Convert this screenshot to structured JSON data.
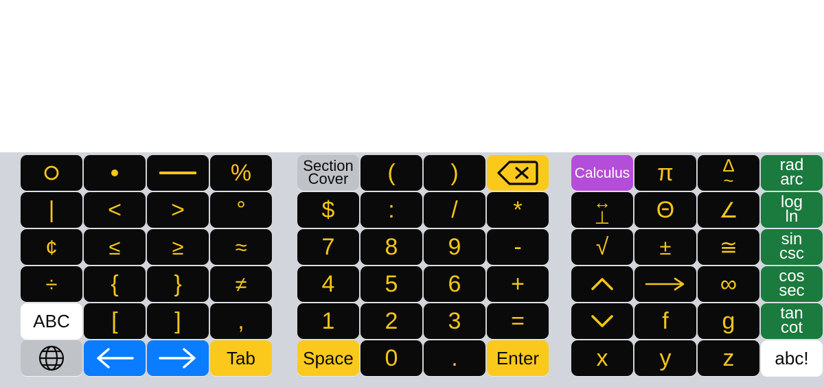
{
  "app": {
    "screen_name": "math-symbol-keyboard",
    "background_color": "#ffffff",
    "keyboard_background": "#d2d5db"
  },
  "colors": {
    "key_black": "#0a0a0a",
    "key_text_yellow": "#f5c518",
    "key_yellow": "#fbc91b",
    "key_blue": "#0a7cff",
    "key_green": "#1b7a3d",
    "key_purple": "#b44dd9",
    "key_light_gray": "#bfc2c7",
    "key_white": "#ffffff"
  },
  "sections": [
    {
      "id": "left",
      "name": "symbols-section",
      "rows": [
        [
          {
            "name": "key-degree-circle",
            "label": "o",
            "style": "black",
            "size": "sym",
            "icon": "circle-glyph"
          },
          {
            "name": "key-middle-dot",
            "label": "•",
            "style": "black",
            "size": "sym",
            "icon": "dot-glyph"
          },
          {
            "name": "key-em-dash",
            "label": "—",
            "style": "black",
            "size": "sym",
            "icon": "dash-glyph"
          },
          {
            "name": "key-percent",
            "label": "%",
            "style": "black",
            "size": "big"
          }
        ],
        [
          {
            "name": "key-vertical-bar",
            "label": "|",
            "style": "black",
            "size": "big"
          },
          {
            "name": "key-less-than",
            "label": "<",
            "style": "black",
            "size": "big"
          },
          {
            "name": "key-greater-than",
            "label": ">",
            "style": "black",
            "size": "big"
          },
          {
            "name": "key-degree",
            "label": "°",
            "style": "black",
            "size": "big"
          }
        ],
        [
          {
            "name": "key-cent",
            "label": "¢",
            "style": "black",
            "size": "sym"
          },
          {
            "name": "key-less-equal",
            "label": "≤",
            "style": "black",
            "size": "sym"
          },
          {
            "name": "key-greater-equal",
            "label": "≥",
            "style": "black",
            "size": "sym"
          },
          {
            "name": "key-approx",
            "label": "≈",
            "style": "black",
            "size": "sym"
          }
        ],
        [
          {
            "name": "key-divide",
            "label": "÷",
            "style": "black",
            "size": "sym"
          },
          {
            "name": "key-brace-open",
            "label": "{",
            "style": "black",
            "size": "big"
          },
          {
            "name": "key-brace-close",
            "label": "}",
            "style": "black",
            "size": "big"
          },
          {
            "name": "key-not-equal",
            "label": "≠",
            "style": "black",
            "size": "sym"
          }
        ],
        [
          {
            "name": "key-abc-uppercase",
            "label": "ABC",
            "style": "white",
            "size": "word"
          },
          {
            "name": "key-bracket-open",
            "label": "[",
            "style": "black",
            "size": "big"
          },
          {
            "name": "key-bracket-close",
            "label": "]",
            "style": "black",
            "size": "big"
          },
          {
            "name": "key-comma",
            "label": ",",
            "style": "black",
            "size": "big"
          }
        ],
        [
          {
            "name": "key-globe",
            "label": "",
            "style": "light",
            "size": "sym",
            "icon": "globe-icon"
          },
          {
            "name": "key-arrow-left",
            "label": "←",
            "style": "blue",
            "size": "big",
            "icon": "arrow-left-icon"
          },
          {
            "name": "key-arrow-right",
            "label": "→",
            "style": "blue",
            "size": "big",
            "icon": "arrow-right-icon"
          },
          {
            "name": "key-tab",
            "label": "Tab",
            "style": "yellow",
            "size": "word"
          }
        ]
      ]
    },
    {
      "id": "middle",
      "name": "numeric-section",
      "rows": [
        [
          {
            "name": "key-section-cover",
            "label": "",
            "style": "light",
            "size": "small",
            "lines": [
              "Section",
              "Cover"
            ]
          },
          {
            "name": "key-paren-open",
            "label": "(",
            "style": "black",
            "size": "big"
          },
          {
            "name": "key-paren-close",
            "label": ")",
            "style": "black",
            "size": "big"
          },
          {
            "name": "key-backspace",
            "label": "",
            "style": "yellow",
            "size": "sym",
            "icon": "backspace-icon"
          }
        ],
        [
          {
            "name": "key-dollar",
            "label": "$",
            "style": "black",
            "size": "big"
          },
          {
            "name": "key-colon",
            "label": ":",
            "style": "black",
            "size": "big"
          },
          {
            "name": "key-slash",
            "label": "/",
            "style": "black",
            "size": "big"
          },
          {
            "name": "key-asterisk",
            "label": "*",
            "style": "black",
            "size": "big"
          }
        ],
        [
          {
            "name": "key-7",
            "label": "7",
            "style": "black",
            "size": "big"
          },
          {
            "name": "key-8",
            "label": "8",
            "style": "black",
            "size": "big"
          },
          {
            "name": "key-9",
            "label": "9",
            "style": "black",
            "size": "big"
          },
          {
            "name": "key-minus",
            "label": "-",
            "style": "black",
            "size": "big"
          }
        ],
        [
          {
            "name": "key-4",
            "label": "4",
            "style": "black",
            "size": "big"
          },
          {
            "name": "key-5",
            "label": "5",
            "style": "black",
            "size": "big"
          },
          {
            "name": "key-6",
            "label": "6",
            "style": "black",
            "size": "big"
          },
          {
            "name": "key-plus",
            "label": "+",
            "style": "black",
            "size": "big"
          }
        ],
        [
          {
            "name": "key-1",
            "label": "1",
            "style": "black",
            "size": "big"
          },
          {
            "name": "key-2",
            "label": "2",
            "style": "black",
            "size": "big"
          },
          {
            "name": "key-3",
            "label": "3",
            "style": "black",
            "size": "big"
          },
          {
            "name": "key-equals",
            "label": "=",
            "style": "black",
            "size": "big"
          }
        ],
        [
          {
            "name": "key-space",
            "label": "Space",
            "style": "yellow",
            "size": "word"
          },
          {
            "name": "key-0",
            "label": "0",
            "style": "black",
            "size": "big"
          },
          {
            "name": "key-period",
            "label": ".",
            "style": "black",
            "size": "big"
          },
          {
            "name": "key-enter",
            "label": "Enter",
            "style": "yellow",
            "size": "word"
          }
        ]
      ]
    },
    {
      "id": "right",
      "name": "math-functions-section",
      "rows": [
        [
          {
            "name": "key-calculus",
            "label": "Calculus",
            "style": "purple",
            "size": "small"
          },
          {
            "name": "key-pi",
            "label": "π",
            "style": "black",
            "size": "big"
          },
          {
            "name": "key-delta-similar",
            "label": "",
            "style": "black",
            "size": "sym",
            "mstack": [
              "Δ",
              "~"
            ]
          },
          {
            "name": "key-rad-arc",
            "label": "",
            "style": "green",
            "size": "small",
            "lines": [
              "rad",
              "arc"
            ]
          }
        ],
        [
          {
            "name": "key-parallel-perpendicular",
            "label": "",
            "style": "black",
            "size": "sym",
            "mstack": [
              "↔",
              "⊥"
            ]
          },
          {
            "name": "key-theta",
            "label": "Θ",
            "style": "black",
            "size": "big"
          },
          {
            "name": "key-angle",
            "label": "∠",
            "style": "black",
            "size": "sym"
          },
          {
            "name": "key-log-ln",
            "label": "",
            "style": "green",
            "size": "small",
            "lines": [
              "log",
              "ln"
            ]
          }
        ],
        [
          {
            "name": "key-square-root",
            "label": "√",
            "style": "black",
            "size": "big"
          },
          {
            "name": "key-plus-minus",
            "label": "±",
            "style": "black",
            "size": "sym"
          },
          {
            "name": "key-congruent",
            "label": "≅",
            "style": "black",
            "size": "sym"
          },
          {
            "name": "key-sin-csc",
            "label": "",
            "style": "green",
            "size": "small",
            "lines": [
              "sin",
              "csc"
            ]
          }
        ],
        [
          {
            "name": "key-caret-up",
            "label": "⌃",
            "style": "black",
            "size": "sym",
            "icon": "chevron-up-icon"
          },
          {
            "name": "key-long-arrow-right",
            "label": "⟶",
            "style": "black",
            "size": "sym",
            "icon": "long-arrow-right-icon"
          },
          {
            "name": "key-infinity",
            "label": "∞",
            "style": "black",
            "size": "big"
          },
          {
            "name": "key-cos-sec",
            "label": "",
            "style": "green",
            "size": "small",
            "lines": [
              "cos",
              "sec"
            ]
          }
        ],
        [
          {
            "name": "key-caret-down",
            "label": "⌄",
            "style": "black",
            "size": "sym",
            "icon": "chevron-down-icon"
          },
          {
            "name": "key-f",
            "label": "f",
            "style": "black",
            "size": "big"
          },
          {
            "name": "key-g",
            "label": "g",
            "style": "black",
            "size": "big"
          },
          {
            "name": "key-tan-cot",
            "label": "",
            "style": "green",
            "size": "small",
            "lines": [
              "tan",
              "cot"
            ]
          }
        ],
        [
          {
            "name": "key-x",
            "label": "x",
            "style": "black",
            "size": "big"
          },
          {
            "name": "key-y",
            "label": "y",
            "style": "black",
            "size": "big"
          },
          {
            "name": "key-z",
            "label": "z",
            "style": "black",
            "size": "big"
          },
          {
            "name": "key-abc-lowercase",
            "label": "abc!",
            "style": "white",
            "size": "word"
          }
        ]
      ]
    }
  ]
}
